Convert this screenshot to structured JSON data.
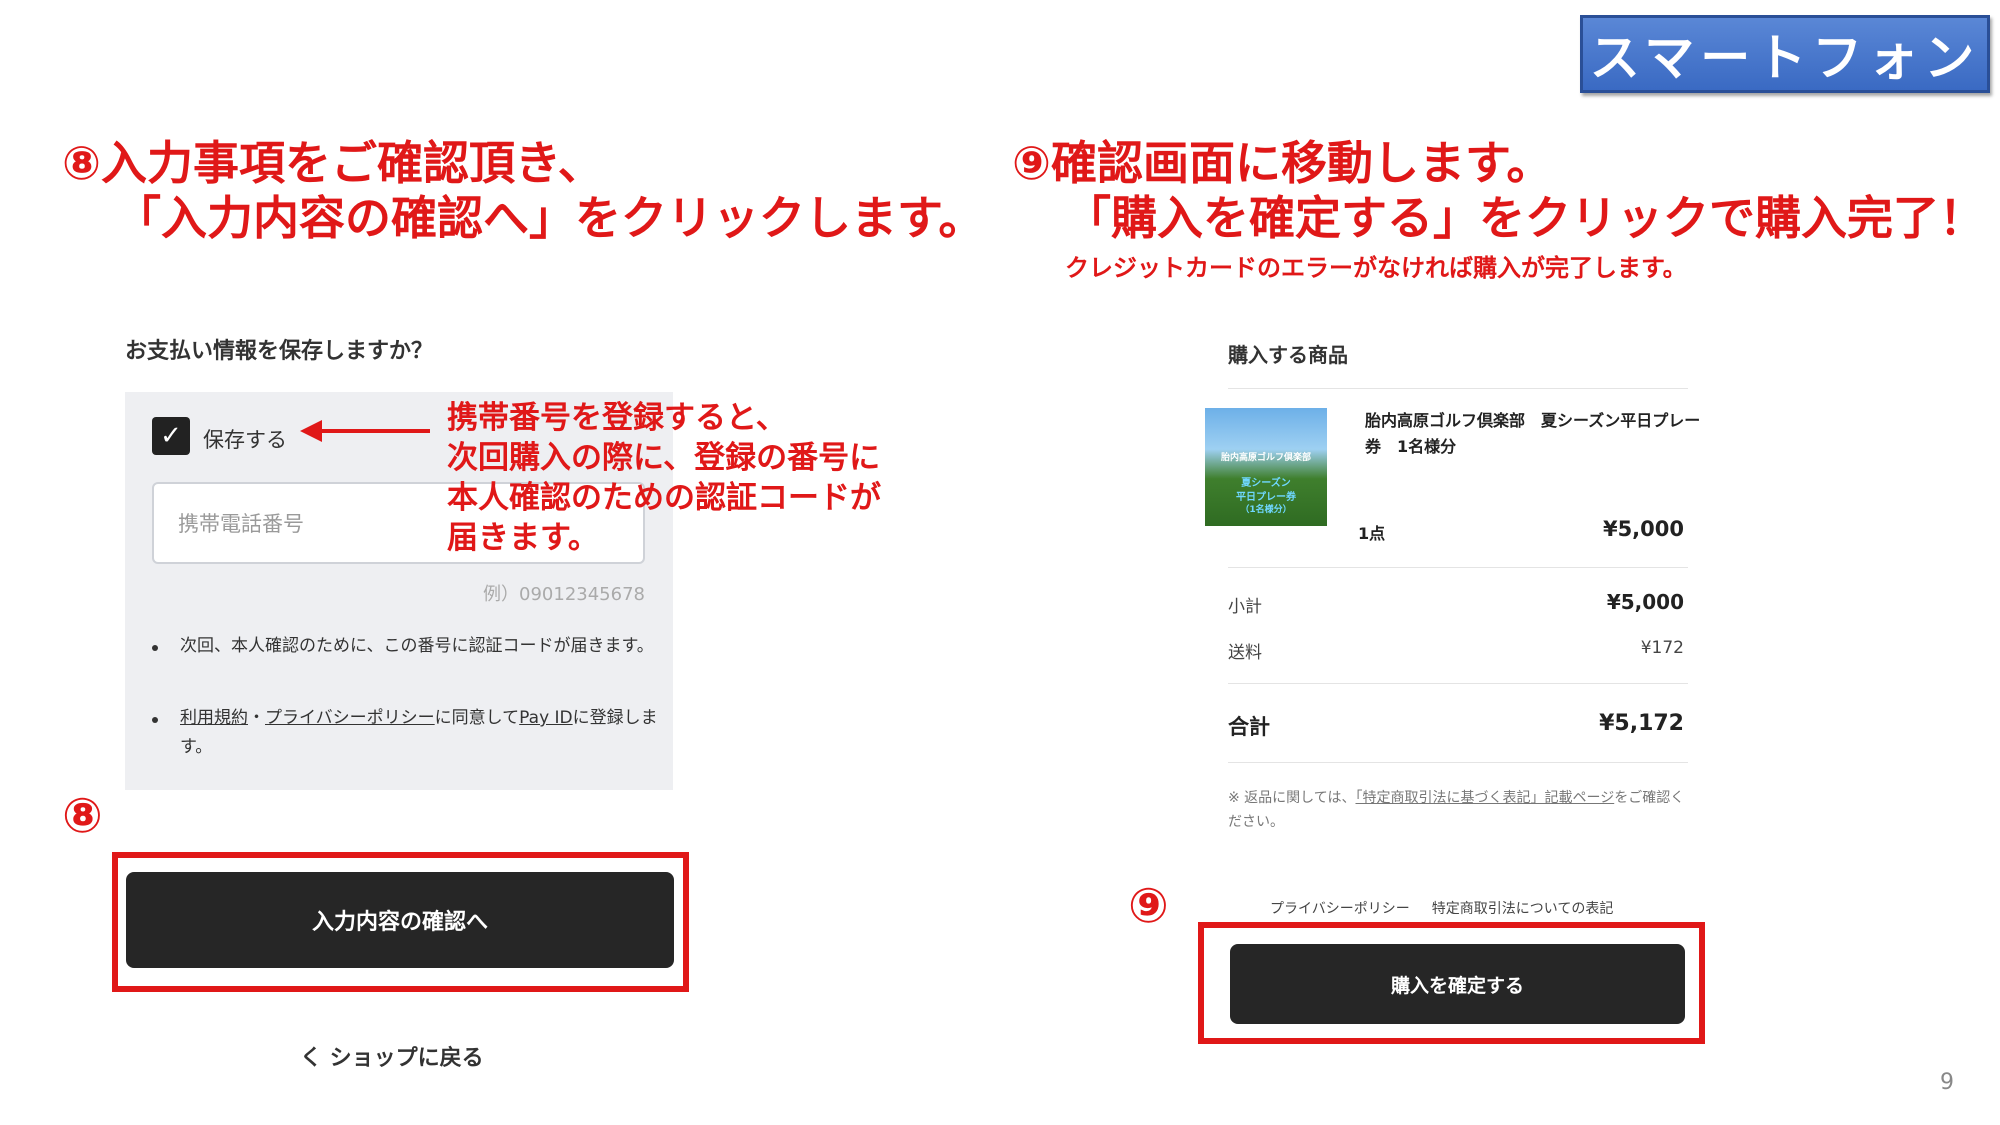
{
  "badge": "スマートフォン",
  "step8": {
    "line1": "⑧入力事項をご確認頂き、",
    "line2": "「入力内容の確認へ」をクリックします。",
    "marker": "⑧"
  },
  "step9": {
    "line1": "⑨確認画面に移動します。",
    "line2": "「購入を確定する」をクリックで購入完了！",
    "sub": "クレジットカードのエラーがなければ購入が完了します。",
    "marker": "⑨"
  },
  "left_panel": {
    "question": "お支払い情報を保存しますか？",
    "save_label": "保存する",
    "phone_placeholder": "携帯電話番号",
    "example": "例）09012345678",
    "bullet1": "次回、本人確認のために、この番号に認証コードが届きます。",
    "bullet2_terms": "利用規約",
    "bullet2_sep": "・",
    "bullet2_privacy": "プライバシーポリシー",
    "bullet2_mid": "に同意して",
    "bullet2_payid": "Pay ID",
    "bullet2_end": "に登録します。",
    "confirm_button": "入力内容の確認へ",
    "back_link": "く ショップに戻る"
  },
  "annotation": {
    "line1": "携帯番号を登録すると、",
    "line2": "次回購入の際に、登録の番号に",
    "line3": "本人確認のための認証コードが",
    "line4": "届きます。"
  },
  "right_panel": {
    "title": "購入する商品",
    "thumb_line1": "胎内高原ゴルフ倶楽部",
    "thumb_line2": "夏シーズン",
    "thumb_line3": "平日プレー券",
    "thumb_line4": "（1名様分）",
    "product_name": "胎内高原ゴルフ倶楽部　夏シーズン平日プレー券　1名様分",
    "quantity": "1点",
    "item_price": "¥5,000",
    "subtotal_label": "小計",
    "subtotal": "¥5,000",
    "shipping_label": "送料",
    "shipping": "¥172",
    "total_label": "合計",
    "total": "¥5,172",
    "note_prefix": "※ 返品に関しては、",
    "note_link": "「特定商取引法に基づく表記」記載ページ",
    "note_suffix": "をご確認ください。",
    "footer_privacy": "プライバシーポリシー",
    "footer_law": "特定商取引法についての表記",
    "purchase_button": "購入を確定する"
  },
  "page_number": "9",
  "colors": {
    "accent_red": "#e01818",
    "badge_blue": "#4a78cc",
    "button_dark": "#262626",
    "panel_gray": "#eeeff2"
  }
}
